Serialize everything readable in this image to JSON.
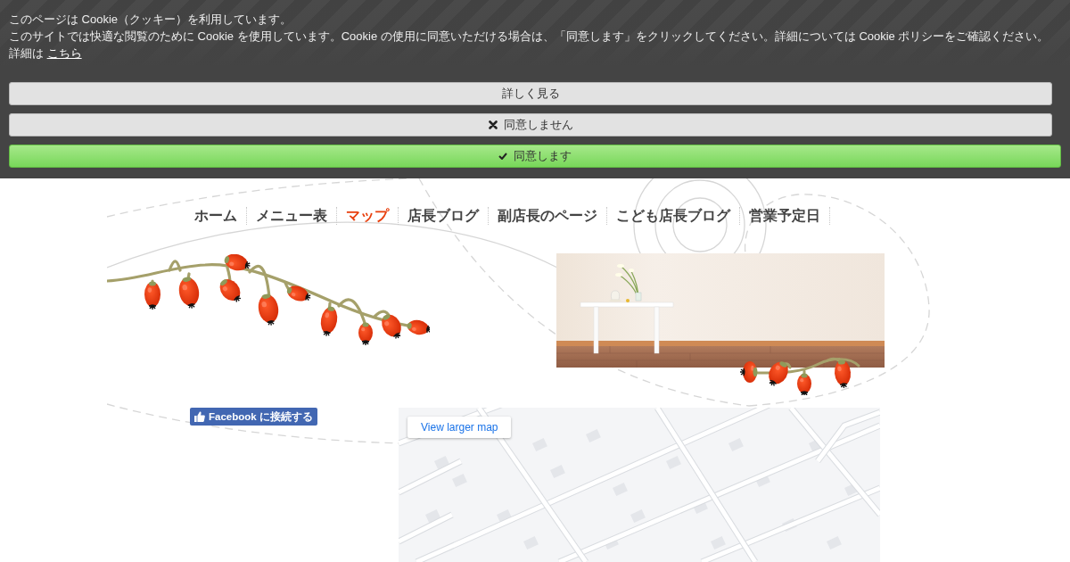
{
  "cookie_banner": {
    "title": "このページは Cookie（クッキー）を利用しています。",
    "message": "このサイトでは快適な閲覧のために Cookie を使用しています。Cookie の使用に同意いただける場合は、「同意します」をクリックしてください。詳細については Cookie ポリシーをご確認ください。",
    "details_prefix": "詳細は",
    "details_link": "こちら",
    "buttons": [
      {
        "kind": "more",
        "label": "詳しく見る"
      },
      {
        "kind": "decline",
        "label": "同意しません"
      },
      {
        "kind": "accept",
        "label": "同意します"
      }
    ]
  },
  "nav": {
    "items": [
      {
        "label": "ホーム",
        "selected": false
      },
      {
        "label": "メニュー表",
        "selected": false
      },
      {
        "label": "マップ",
        "selected": true
      },
      {
        "label": "店長ブログ",
        "selected": false
      },
      {
        "label": "副店長のページ",
        "selected": false
      },
      {
        "label": "こども店長ブログ",
        "selected": false
      },
      {
        "label": "営業予定日",
        "selected": false
      }
    ]
  },
  "facebook_button": {
    "label": "Facebook に接続する"
  },
  "map": {
    "link_label": "View larger map"
  }
}
